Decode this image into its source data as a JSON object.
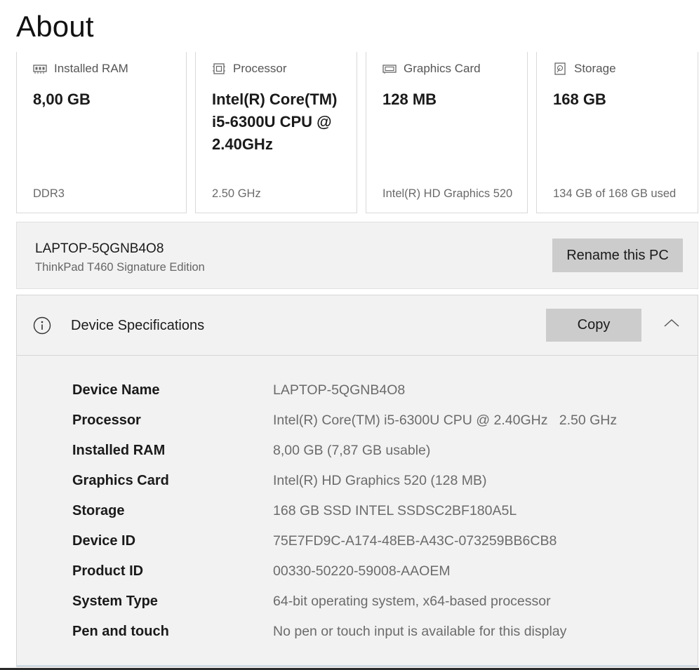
{
  "page": {
    "title": "About"
  },
  "cards": [
    {
      "label": "Installed RAM",
      "value": "8,00 GB",
      "sub": "DDR3",
      "icon": "ram-icon"
    },
    {
      "label": "Processor",
      "value": "Intel(R) Core(TM) i5-6300U CPU @ 2.40GHz",
      "sub": "2.50 GHz",
      "icon": "processor-icon"
    },
    {
      "label": "Graphics Card",
      "value": "128 MB",
      "sub": "Intel(R) HD Graphics 520",
      "icon": "graphics-card-icon"
    },
    {
      "label": "Storage",
      "value": "168 GB",
      "sub": "134 GB of 168 GB used",
      "icon": "storage-icon"
    }
  ],
  "pc": {
    "name": "LAPTOP-5QGNB4O8",
    "model": "ThinkPad T460 Signature Edition",
    "rename_label": "Rename this PC"
  },
  "specs": {
    "title": "Device Specifications",
    "copy_label": "Copy",
    "rows": [
      {
        "key": "Device Name",
        "value": "LAPTOP-5QGNB4O8"
      },
      {
        "key": "Processor",
        "value": "Intel(R) Core(TM) i5-6300U CPU @ 2.40GHz   2.50 GHz"
      },
      {
        "key": "Installed RAM",
        "value": "8,00 GB (7,87 GB usable)"
      },
      {
        "key": "Graphics Card",
        "value": "Intel(R) HD Graphics 520 (128 MB)"
      },
      {
        "key": "Storage",
        "value": "168 GB SSD INTEL SSDSC2BF180A5L"
      },
      {
        "key": "Device ID",
        "value": "75E7FD9C-A174-48EB-A43C-073259BB6CB8"
      },
      {
        "key": "Product ID",
        "value": "00330-50220-59008-AAOEM"
      },
      {
        "key": "System Type",
        "value": "64-bit operating system, x64-based processor"
      },
      {
        "key": "Pen and touch",
        "value": "No pen or touch input is available for this display"
      }
    ]
  },
  "colors": {
    "panel_bg": "#f2f2f2",
    "button_bg": "#cccccc",
    "muted_text": "#6b6b6b"
  }
}
